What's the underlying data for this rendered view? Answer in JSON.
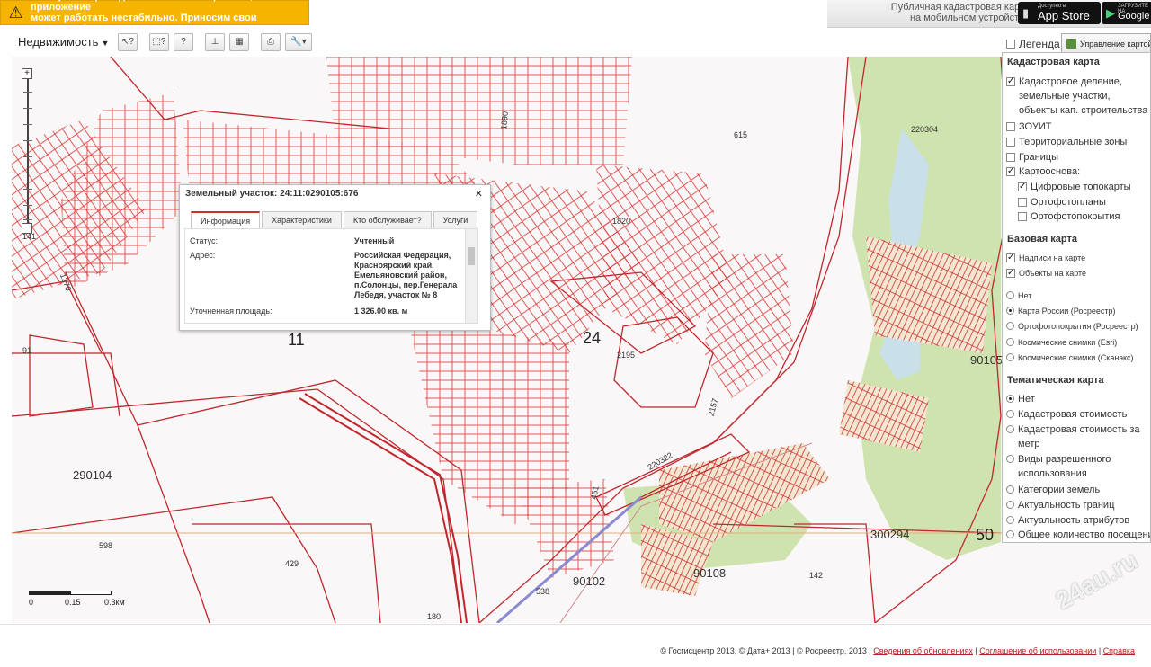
{
  "banner": {
    "warning_text": "На портале проводятся технические работы, приложение\nможет работать нестабильно. Приносим свои извинения!",
    "mobile_text": "Публичная кадастровая карта\nна мобильном устройстве",
    "appstore_small": "Доступно в",
    "appstore_big": "App Store",
    "google_small": "ЗАГРУЗИТЕ НА",
    "google_big": "Google"
  },
  "toolbar": {
    "dropdown_label": "Недвижимость",
    "legend_label": "Легенда",
    "manage_tab_label": "Управление картой"
  },
  "popup": {
    "title": "Земельный участок: 24:11:0290105:676",
    "tabs": [
      "Информация",
      "Характеристики",
      "Кто обслуживает?",
      "Услуги"
    ],
    "rows": [
      {
        "label": "Статус:",
        "value": "Учтенный"
      },
      {
        "label": "Адрес:",
        "value": "Российская Федерация,\nКрасноярский край,\nЕмельяновский район,\nп.Солонцы, пер.Генерала\nЛебедя, участок № 8"
      },
      {
        "label": "Уточненная площадь:",
        "value": "1 326.00 кв. м"
      }
    ]
  },
  "map": {
    "labels": [
      "615",
      "220304",
      "1820",
      "2195",
      "2157",
      "220322",
      "451",
      "90105",
      "300294",
      "50",
      "90108",
      "142",
      "90102",
      "538",
      "180",
      "429",
      "598",
      "290104",
      "91",
      "11",
      "24",
      "141",
      "1270",
      "1890"
    ],
    "scale": {
      "labels": [
        "0",
        "0.15",
        "0.3км"
      ]
    }
  },
  "panel": {
    "cadastral_title": "Кадастровая карта",
    "cadastral_items": [
      {
        "label": "Кадастровое деление, земельные участки, объекты кап. строительства",
        "checked": true
      },
      {
        "label": "ЗОУИТ",
        "checked": false
      },
      {
        "label": "Территориальные зоны",
        "checked": false
      },
      {
        "label": "Границы",
        "checked": false
      },
      {
        "label": "Картооснова:",
        "checked": true
      }
    ],
    "basemap_sub": [
      {
        "label": "Цифровые топокарты",
        "checked": true
      },
      {
        "label": "Ортофотопланы",
        "checked": false
      },
      {
        "label": "Ортофотопокрытия",
        "checked": false
      }
    ],
    "base_title": "Базовая карта",
    "base_checks": [
      {
        "label": "Надписи на карте",
        "checked": true
      },
      {
        "label": "Объекты на карте",
        "checked": true
      }
    ],
    "base_radios": [
      {
        "label": "Нет",
        "selected": false
      },
      {
        "label": "Карта России (Росреестр)",
        "selected": true
      },
      {
        "label": "Ортофотопокрытия (Росреестр)",
        "selected": false
      },
      {
        "label": "Космические снимки (Esri)",
        "selected": false
      },
      {
        "label": "Космические снимки (Сканэкс)",
        "selected": false
      }
    ],
    "thematic_title": "Тематическая карта",
    "thematic_radios": [
      {
        "label": "Нет",
        "selected": true
      },
      {
        "label": "Кадастровая стоимость",
        "selected": false
      },
      {
        "label": "Кадастровая стоимость за метр",
        "selected": false
      },
      {
        "label": "Виды разрешенного использования",
        "selected": false
      },
      {
        "label": "Категории земель",
        "selected": false
      },
      {
        "label": "Актуальность границ",
        "selected": false
      },
      {
        "label": "Актуальность атрибутов",
        "selected": false
      },
      {
        "label": "Общее количество посещений",
        "selected": false
      }
    ]
  },
  "footer": {
    "copyright": "© Госгисцентр 2013, © Дата+ 2013 | © Росреестр, 2013 |",
    "link1": "Сведения об обновлениях",
    "link2": "Соглашение об использовании",
    "link3": "Справка"
  },
  "watermark": "24au.ru"
}
